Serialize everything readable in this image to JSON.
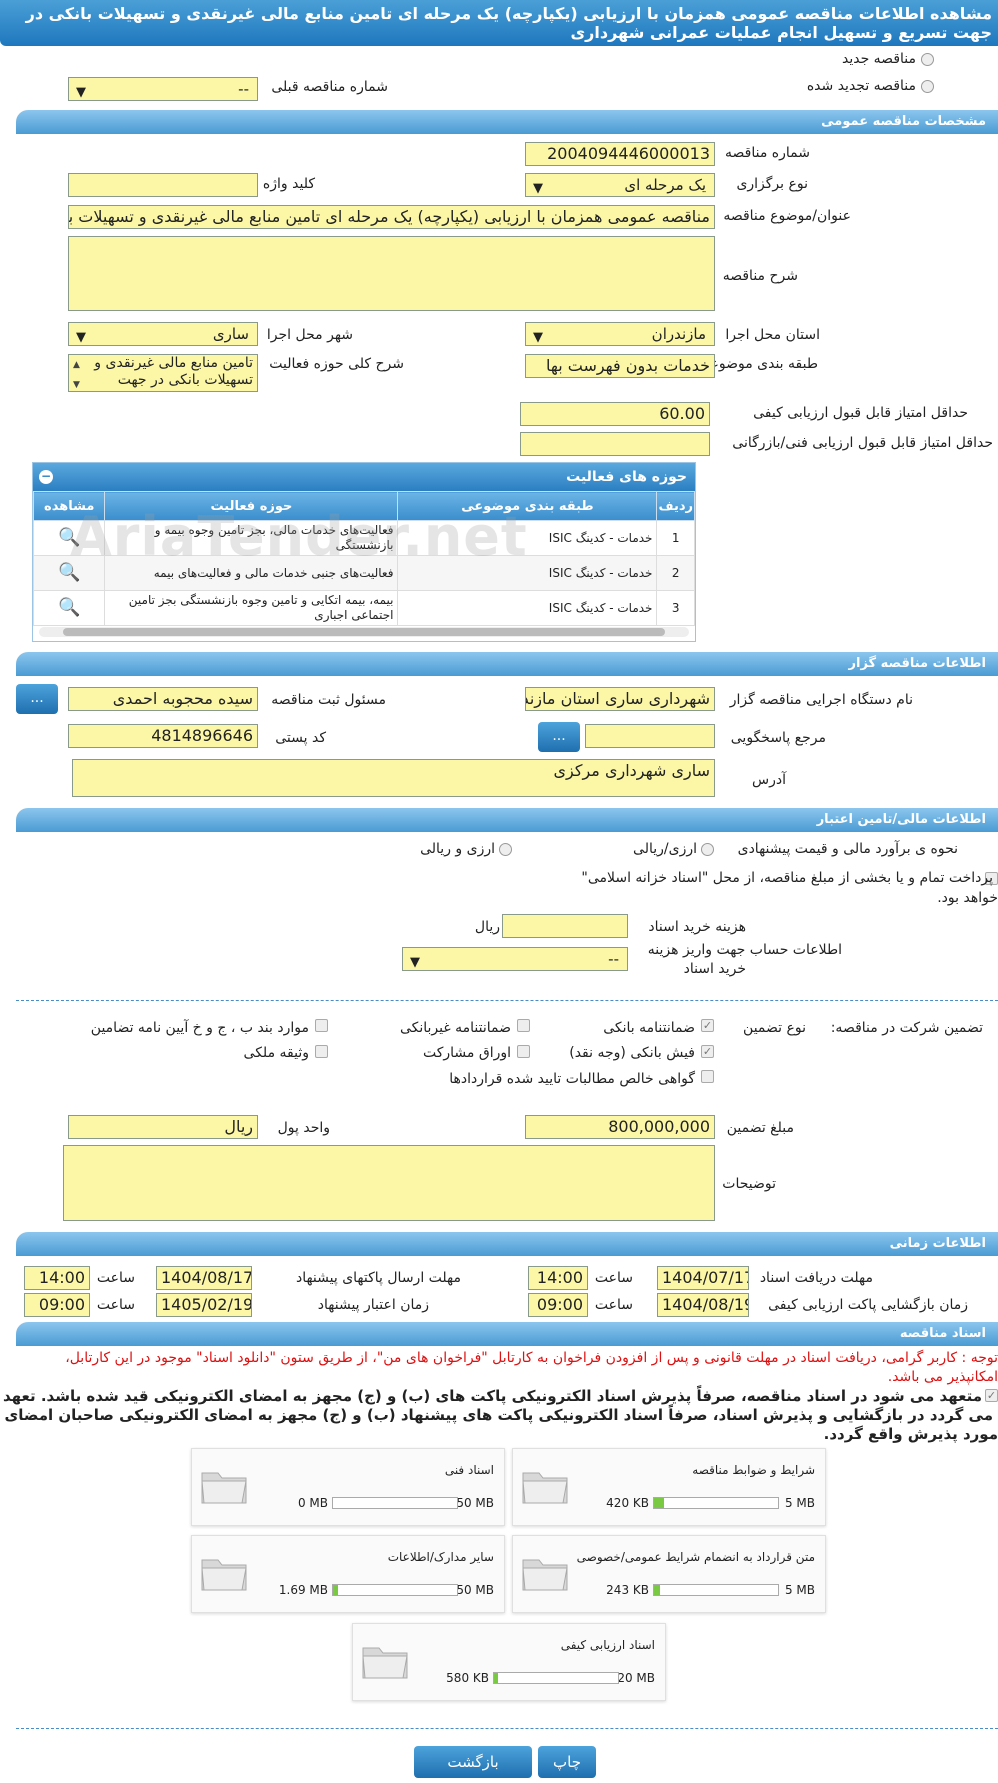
{
  "header": {
    "title": "مشاهده اطلاعات مناقصه عمومی همزمان با ارزیابی (یکپارچه) یک مرحله ای تامین منابع مالی غیرنقدی و تسهیلات بانکی در جهت تسریع و تسهیل انجام عملیات عمرانی شهرداری"
  },
  "type": {
    "new_label": "مناقصه جدید",
    "renewed_label": "مناقصه تجدید شده",
    "prev_no_label": "شماره مناقصه قبلی",
    "prev_no_value": "--"
  },
  "general": {
    "title": "مشخصات مناقصه عمومی",
    "number_label": "شماره مناقصه",
    "number_value": "2004094446000013",
    "method_label": "نوع برگزاری",
    "method_value": "یک مرحله ای",
    "keyword_label": "کلید واژه",
    "keyword_value": "",
    "subject_label": "عنوان/موضوع مناقصه",
    "subject_value": "مناقصه عمومی همزمان با ارزیابی (یکپارچه) یک مرحله ای تامین منابع مالی غیرنقدی و تسهیلات بانکی",
    "desc_label": "شرح مناقصه",
    "desc_value": "",
    "province_label": "استان محل اجرا",
    "province_value": "مازندران",
    "city_label": "شهر محل اجرا",
    "city_value": "ساری",
    "category_label": "طبقه بندی موضوعی",
    "category_value": "خدمات بدون فهرست بها",
    "scope_label": "شرح کلی حوزه فعالیت",
    "scope_value": "تامین منابع مالی غیرنقدی و تسهیلات بانکی در جهت",
    "min_quality_label": "حداقل امتیاز قابل قبول ارزیابی کیفی",
    "min_quality_value": "60.00",
    "min_tech_label": "حداقل امتیاز قابل قبول ارزیابی فنی/بازرگانی",
    "min_tech_value": ""
  },
  "activities": {
    "title": "حوزه های فعالیت",
    "columns": {
      "row": "ردیف",
      "category": "طبقه بندی موضوعی",
      "field": "حوزه فعالیت",
      "view": "مشاهده"
    },
    "rows": [
      {
        "row": "1",
        "category": "خدمات - کدینگ ISIC",
        "field": "فعالیت‌های خدمات مالی، بجز تامین وجوه بیمه و بازنشستگی"
      },
      {
        "row": "2",
        "category": "خدمات - کدینگ ISIC",
        "field": "فعالیت‌های جنبی خدمات مالی و فعالیت‌های بیمه"
      },
      {
        "row": "3",
        "category": "خدمات - کدینگ ISIC",
        "field": "بیمه، بیمه اتکایی و تامین وجوه بازنشستگی بجز تامین اجتماعی اجباری"
      }
    ]
  },
  "organizer": {
    "title": "اطلاعات مناقصه گزار",
    "org_label": "نام دستگاه اجرایی مناقصه گزار",
    "org_value": "شهرداری ساری استان مازندران",
    "resp_label": "مسئول ثبت مناقصه",
    "resp_value": "سیده محجوبه احمدی",
    "ref_label": "مرجع پاسخگویی",
    "ref_value": "",
    "postal_label": "کد پستی",
    "postal_value": "4814896646",
    "address_label": "آدرس",
    "address_value": "ساری شهرداری مرکزی",
    "more_button": "..."
  },
  "finance": {
    "title": "اطلاعات مالی/تامین اعتبار",
    "estimate_label": "نحوه ی برآورد مالی و قیمت پیشنهادی",
    "opt_rial": "ارزی/ریالی",
    "opt_both": "ارزی و ریالی",
    "islamic_line1": "پرداخت تمام و یا بخشی از مبلغ مناقصه، از محل \"اسناد خزانه اسلامی\"",
    "islamic_line2": "خواهد بود.",
    "doc_cost_label": "هزینه خرید اسناد",
    "doc_cost_value": "",
    "doc_cost_unit": "ریال",
    "account_label_1": "اطلاعات حساب جهت واریز هزینه",
    "account_label_2": "خرید اسناد",
    "account_value": "--"
  },
  "guarantee": {
    "participation_label": "تضمین شرکت در مناقصه:",
    "type_label": "نوع تضمین",
    "bank_guarantee": "ضمانتنامه بانکی",
    "nonbank_guarantee": "ضمانتنامه غیربانکی",
    "regulation_items": "موارد بند ب ، ج و خ آیین نامه تضامین",
    "cash_receipt": "فیش بانکی (وجه نقد)",
    "bonds": "اوراق مشارکت",
    "property": "وثیقه ملکی",
    "receivables": "گواهی خالص مطالبات تایید شده قراردادها",
    "amount_label": "مبلغ تضمین",
    "amount_value": "800,000,000",
    "currency_label": "واحد پول",
    "currency_value": "ریال",
    "notes_label": "توضیحات",
    "notes_value": ""
  },
  "timing": {
    "title": "اطلاعات زمانی",
    "receive_label": "مهلت دریافت اسناد",
    "receive_date": "1404/07/17",
    "receive_time": "14:00",
    "submit_label": "مهلت ارسال پاکتهای پیشنهاد",
    "submit_date": "1404/08/17",
    "submit_time": "14:00",
    "open_label": "زمان بازگشایی پاکت ارزیابی کیفی",
    "open_date": "1404/08/19",
    "open_time": "09:00",
    "valid_label": "زمان اعتبار پیشنهاد",
    "valid_date": "1405/02/19",
    "valid_time": "09:00",
    "time_label": "ساعت"
  },
  "documents": {
    "title": "اسناد مناقصه",
    "notice_line1": "توجه : کاربر گرامی، دریافت اسناد در مهلت قانونی و پس از افزودن فراخوان به کارتابل \"فراخوان های من\"، از طریق ستون \"دانلود اسناد\" موجود در این کارتابل،",
    "notice_line2": "امکانپذیر می باشد.",
    "commit_line1": "متعهد می شود در اسناد مناقصه، صرفاً پذیرش اسناد الکترونیکی پاکت های (ب) و (ج) مجهز به امضای الکترونیکی قید شده باشد. تعهد",
    "commit_line2": "می گردد در بازگشایی و پذیرش اسناد، صرفاً اسناد الکترونیکی پاکت های پیشنهاد (ب) و (ج) مجهز به امضای الکترونیکی صاحبان امضای مجاز",
    "commit_line3": "مورد پذیرش واقع گردد.",
    "files": [
      {
        "name": "شرایط و ضوابط مناقصه",
        "current": "420 KB",
        "max": "5 MB",
        "pct": 8
      },
      {
        "name": "اسناد فنی",
        "current": "0 MB",
        "max": "50 MB",
        "pct": 0
      },
      {
        "name": "متن قرارداد به انضمام شرایط عمومی/خصوصی",
        "current": "243 KB",
        "max": "5 MB",
        "pct": 5
      },
      {
        "name": "سایر مدارک/اطلاعات",
        "current": "1.69 MB",
        "max": "50 MB",
        "pct": 4
      },
      {
        "name": "اسناد ارزیابی کیفی",
        "current": "580 KB",
        "max": "20 MB",
        "pct": 3
      }
    ]
  },
  "actions": {
    "print": "چاپ",
    "back": "بازگشت"
  },
  "watermark": "AriaTender.net",
  "colors": {
    "accent": "#2a86c8",
    "field": "#fbf7a7",
    "notice": "#dd1111"
  }
}
